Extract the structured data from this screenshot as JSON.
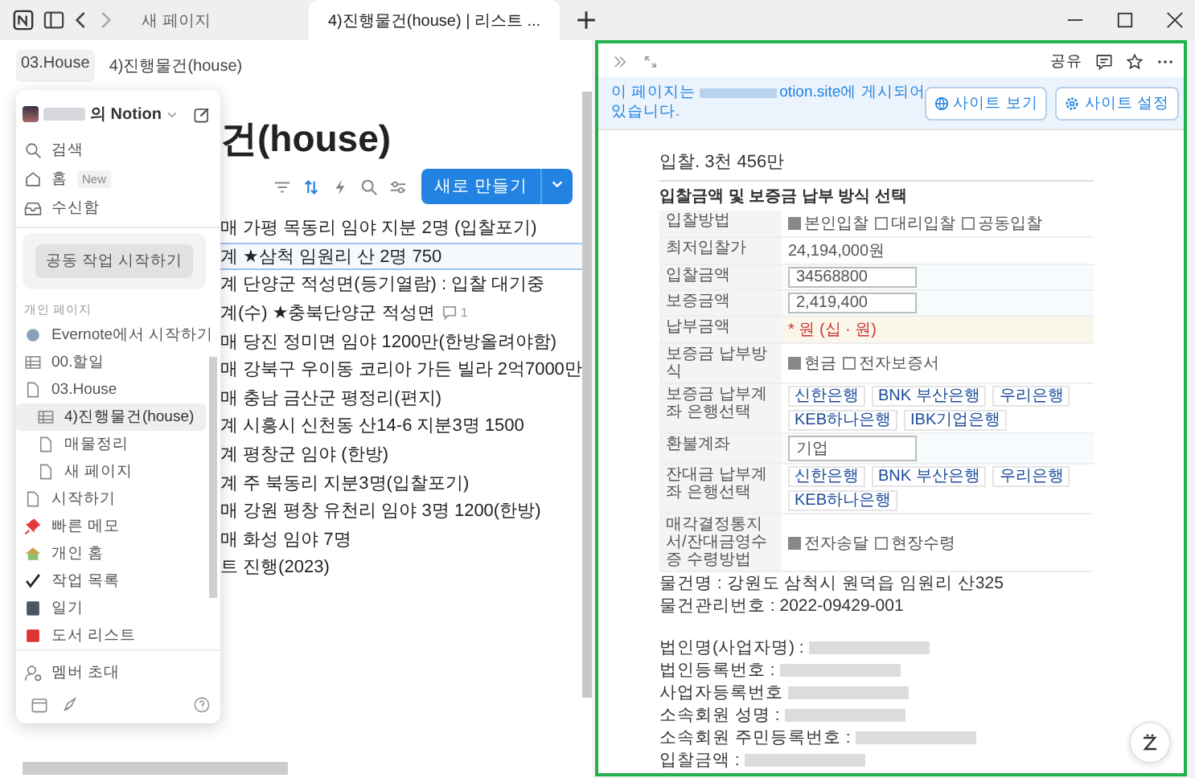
{
  "tabs": [
    {
      "label": "새 페이지",
      "selected": false
    },
    {
      "label": "4)진행물건(house) | 리스트 ...",
      "selected": true
    }
  ],
  "breadcrumbs": [
    "03.House",
    "4)진행물건(house)"
  ],
  "page": {
    "title": "건(house)",
    "new_button": "새로 만들기",
    "rows": [
      {
        "text": "매 가평 목동리 임야 지분 2명 (입찰포기)",
        "selected": false
      },
      {
        "text": "계 ★삼척 임원리 산 2명 750",
        "selected": true
      },
      {
        "text": "계 단양군 적성면(등기열람) : 입찰 대기중",
        "selected": false
      },
      {
        "text": "계(수) ★충북단양군 적성면",
        "selected": false,
        "comments": "1"
      },
      {
        "text": "매 당진 정미면 임야 1200만(한방올려야함)",
        "selected": false
      },
      {
        "text": "매 강북구 우이동 코리아 가든 빌라 2억7000만",
        "selected": false
      },
      {
        "text": "매 충남 금산군 평정리(편지)",
        "selected": false
      },
      {
        "text": "계 시흥시 신천동 산14-6 지분3명 1500",
        "selected": false
      },
      {
        "text": "계 평창군 임야 (한방)",
        "selected": false
      },
      {
        "text": "계 주 북동리 지분3명(입찰포기)",
        "selected": false
      },
      {
        "text": "매 강원 평창 유천리 임야 3명 1200(한방)",
        "selected": false
      },
      {
        "text": "매 화성 임야 7명",
        "selected": false
      },
      {
        "text": "트 진행(2023)",
        "selected": false
      }
    ]
  },
  "sidebar": {
    "workspace": "의 Notion",
    "nav": [
      {
        "label": "검색",
        "kind": "search"
      },
      {
        "label": "홈",
        "kind": "home",
        "badge": "New"
      },
      {
        "label": "수신함",
        "kind": "inbox"
      }
    ],
    "collab_button": "공동 작업 시작하기",
    "section": "개인 페이지",
    "items": [
      {
        "label": "Evernote에서 시작하기",
        "kind": "globe",
        "selected": false
      },
      {
        "label": "00.할일",
        "kind": "table",
        "selected": false
      },
      {
        "label": "03.House",
        "kind": "page",
        "selected": false,
        "children": [
          {
            "label": "4)진행물건(house)",
            "kind": "table",
            "selected": true
          },
          {
            "label": "매물정리",
            "kind": "page",
            "selected": false
          },
          {
            "label": "새 페이지",
            "kind": "page",
            "selected": false
          }
        ]
      },
      {
        "label": "시작하기",
        "kind": "page",
        "selected": false
      },
      {
        "label": "빠른 메모",
        "kind": "pin",
        "selected": false
      },
      {
        "label": "개인 홈",
        "kind": "house",
        "selected": false
      },
      {
        "label": "작업 목록",
        "kind": "check",
        "selected": false
      },
      {
        "label": "일기",
        "kind": "book",
        "selected": false
      },
      {
        "label": "도서 리스트",
        "kind": "redbook",
        "selected": false
      }
    ],
    "invite": "멤버 초대"
  },
  "peek": {
    "share": "공유",
    "banner": {
      "before": "이 페이지는",
      "after": "otion.site에 게시되어",
      "line2": "있습니다.",
      "buttons": [
        "사이트 보기",
        "사이트 설정"
      ]
    },
    "heading": "입찰. 3천 456만",
    "form": {
      "title": "입찰금액 및 보증금 납부 방식 선택",
      "rows": [
        {
          "label": "입찰방법",
          "kind": "options",
          "options": [
            {
              "label": "본인입찰",
              "checked": true
            },
            {
              "label": "대리입찰",
              "checked": false
            },
            {
              "label": "공동입찰",
              "checked": false
            }
          ]
        },
        {
          "label": "최저입찰가",
          "kind": "value",
          "value": "24,194,000원"
        },
        {
          "label": "입찰금액",
          "kind": "input",
          "value": "34568800"
        },
        {
          "label": "보증금액",
          "kind": "input",
          "value": "2,419,400"
        },
        {
          "label": "납부금액",
          "kind": "note",
          "value": "* 원 (십 · 원)"
        },
        {
          "label": "보증금 납부방식",
          "kind": "options",
          "options": [
            {
              "label": "현금",
              "checked": true
            },
            {
              "label": "전자보증서",
              "checked": false
            }
          ]
        },
        {
          "label": "보증금 납부계좌 은행선택",
          "kind": "banks",
          "banks": [
            "신한은행",
            "BNK 부산은행",
            "우리은행",
            "KEB하나은행",
            "IBK기업은행"
          ]
        },
        {
          "label": "환불계좌",
          "kind": "input",
          "value": "기업"
        },
        {
          "label": "잔대금 납부계좌 은행선택",
          "kind": "banks",
          "banks": [
            "신한은행",
            "BNK 부산은행",
            "우리은행",
            "KEB하나은행"
          ]
        },
        {
          "label": "매각결정통지서/잔대금영수증 수령방법",
          "kind": "options",
          "options": [
            {
              "label": "전자송달",
              "checked": true
            },
            {
              "label": "현장수령",
              "checked": false
            }
          ]
        }
      ]
    },
    "lines": [
      {
        "label": "물건명 : 강원도 삼척시 원덕읍 임원리 산325"
      },
      {
        "label": "물건관리번호 : 2022-09429-001",
        "gap_after": true
      },
      {
        "label": "법인명(사업자명) :",
        "redacted": true
      },
      {
        "label": "법인등록번호 :",
        "redacted": true
      },
      {
        "label": "사업자등록번호",
        "redacted": true
      },
      {
        "label": "소속회원 성명 :",
        "redacted": true
      },
      {
        "label": "소속회원 주민등록번호 :",
        "redacted": true
      },
      {
        "label": "입찰금액 :",
        "redacted": true
      }
    ]
  }
}
